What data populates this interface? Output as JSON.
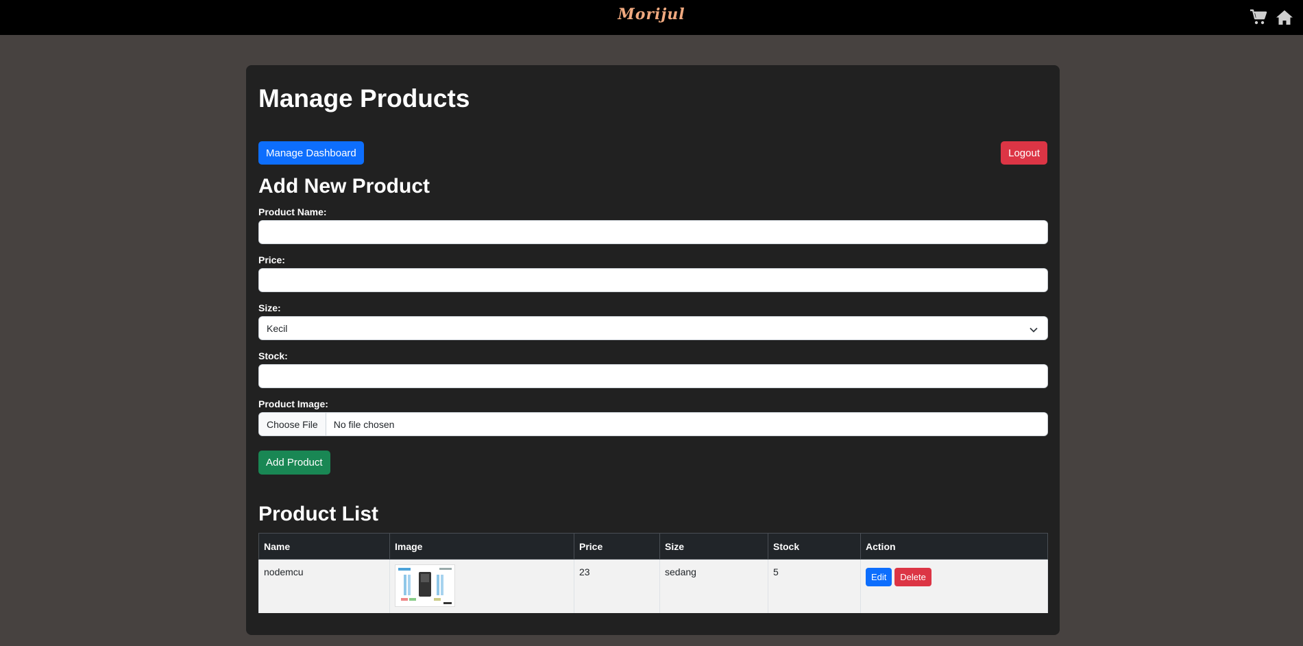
{
  "header": {
    "brand": "Morijul",
    "icons": [
      "cart-icon",
      "home-icon"
    ]
  },
  "page": {
    "title": "Manage Products",
    "dashboard_button": "Manage Dashboard",
    "logout_button": "Logout"
  },
  "form": {
    "heading": "Add New Product",
    "name_label": "Product Name:",
    "name_value": "",
    "price_label": "Price:",
    "price_value": "",
    "size_label": "Size:",
    "size_value": "Kecil",
    "stock_label": "Stock:",
    "stock_value": "",
    "image_label": "Product Image:",
    "choose_file": "Choose File",
    "no_file": "No file chosen",
    "submit": "Add Product"
  },
  "product_list": {
    "heading": "Product List",
    "columns": [
      "Name",
      "Image",
      "Price",
      "Size",
      "Stock",
      "Action"
    ],
    "rows": [
      {
        "name": "nodemcu",
        "price": "23",
        "size": "sedang",
        "stock": "5",
        "edit": "Edit",
        "delete": "Delete"
      }
    ]
  },
  "colors": {
    "primary": "#0d6efd",
    "danger": "#dc3545",
    "success": "#198754",
    "brand": "#f0a97f"
  }
}
